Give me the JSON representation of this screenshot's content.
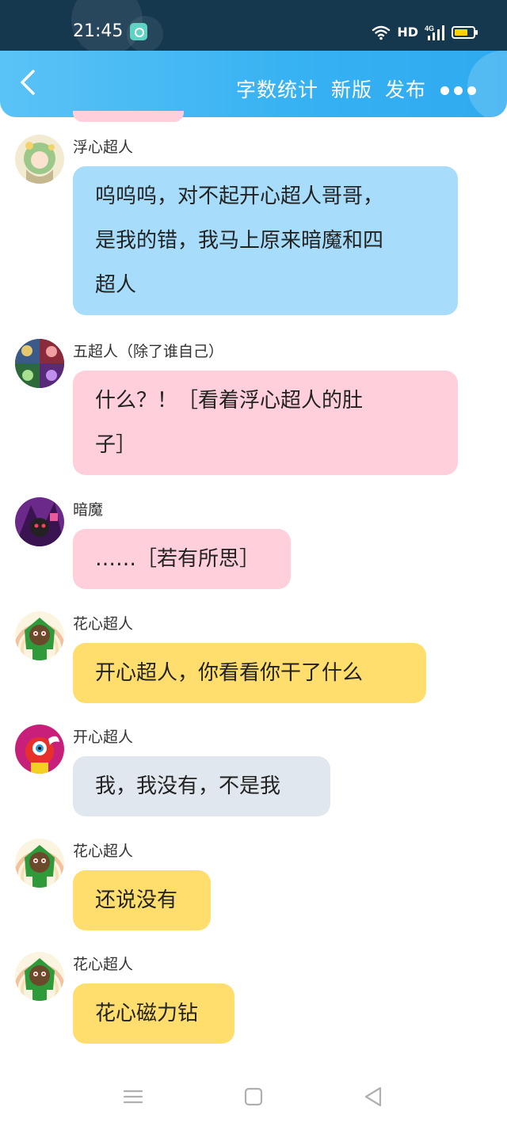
{
  "status_bar": {
    "time": "21:45",
    "network": "HD",
    "signal_type": "4G",
    "icons": [
      "app-icon",
      "wifi-icon",
      "signal-icon",
      "battery-icon"
    ]
  },
  "header": {
    "back_icon": "chevron-left-icon",
    "actions": [
      {
        "label": "字数统计"
      },
      {
        "label": "新版"
      },
      {
        "label": "发布"
      }
    ],
    "more_icon": "more-dots-icon"
  },
  "messages": [
    {
      "sender": "浮心超人",
      "avatar": "green-hair-girl-avatar",
      "text_lines": [
        "呜呜呜，对不起开心超人哥哥，",
        "是我的错，我马上原来暗魔和四",
        "超人"
      ],
      "color": "blue"
    },
    {
      "sender": "五超人（除了谁自己）",
      "avatar": "group-avatar",
      "text_lines": [
        "什么？！［看着浮心超人的肚",
        "子］"
      ],
      "color": "pink"
    },
    {
      "sender": "暗魔",
      "avatar": "dark-demon-avatar",
      "text_lines": [
        "……［若有所思］"
      ],
      "color": "pink"
    },
    {
      "sender": "花心超人",
      "avatar": "green-flower-hero-avatar",
      "text_lines": [
        "开心超人，你看看你干了什么"
      ],
      "color": "yellow"
    },
    {
      "sender": "开心超人",
      "avatar": "red-hero-avatar",
      "text_lines": [
        "我，我没有，不是我"
      ],
      "color": "grey"
    },
    {
      "sender": "花心超人",
      "avatar": "green-flower-hero-avatar",
      "text_lines": [
        "还说没有"
      ],
      "color": "yellow"
    },
    {
      "sender": "花心超人",
      "avatar": "green-flower-hero-avatar",
      "text_lines": [
        "花心磁力钻"
      ],
      "color": "yellow"
    }
  ],
  "colors": {
    "header_start": "#5ac3f6",
    "header_end": "#2eaaf0",
    "bubble_blue": "#a7dcfb",
    "bubble_pink": "#ffcfdc",
    "bubble_yellow": "#ffde6e",
    "bubble_grey": "#e1e7ef"
  },
  "nav_bar": {
    "icons": [
      "menu-icon",
      "home-square-icon",
      "back-triangle-icon"
    ]
  }
}
